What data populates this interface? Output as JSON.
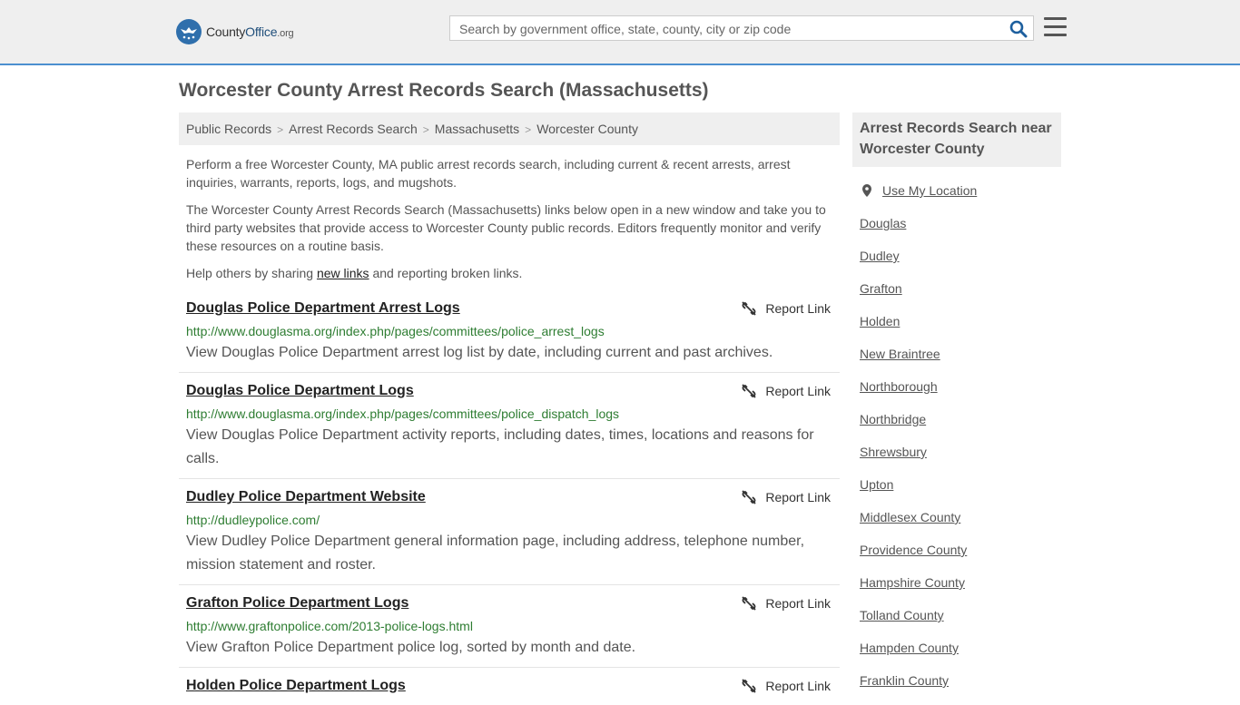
{
  "header": {
    "logo_text_county": "County",
    "logo_text_office": "Office",
    "logo_text_org": ".org",
    "search_placeholder": "Search by government office, state, county, city or zip code",
    "search_icon": "search-icon",
    "menu_icon": "hamburger-menu-icon"
  },
  "page": {
    "title": "Worcester County Arrest Records Search (Massachusetts)"
  },
  "breadcrumb": [
    "Public Records",
    "Arrest Records Search",
    "Massachusetts",
    "Worcester County"
  ],
  "intro": {
    "p1": "Perform a free Worcester County, MA public arrest records search, including current & recent arrests, arrest inquiries, warrants, reports, logs, and mugshots.",
    "p2": "The Worcester County Arrest Records Search (Massachusetts) links below open in a new window and take you to third party websites that provide access to Worcester County public records. Editors frequently monitor and verify these resources on a routine basis.",
    "p3_before": "Help others by sharing ",
    "p3_link": "new links",
    "p3_after": " and reporting broken links."
  },
  "report_label": "Report Link",
  "listings": [
    {
      "title": "Douglas Police Department Arrest Logs",
      "url": "http://www.douglasma.org/index.php/pages/committees/police_arrest_logs",
      "desc": "View Douglas Police Department arrest log list by date, including current and past archives."
    },
    {
      "title": "Douglas Police Department Logs",
      "url": "http://www.douglasma.org/index.php/pages/committees/police_dispatch_logs",
      "desc": "View Douglas Police Department activity reports, including dates, times, locations and reasons for calls."
    },
    {
      "title": "Dudley Police Department Website",
      "url": "http://dudleypolice.com/",
      "desc": "View Dudley Police Department general information page, including address, telephone number, mission statement and roster."
    },
    {
      "title": "Grafton Police Department Logs",
      "url": "http://www.graftonpolice.com/2013-police-logs.html",
      "desc": "View Grafton Police Department police log, sorted by month and date."
    },
    {
      "title": "Holden Police Department Logs",
      "url": "",
      "desc": ""
    }
  ],
  "sidebar": {
    "heading": "Arrest Records Search near Worcester County",
    "use_location": "Use My Location",
    "items": [
      "Douglas",
      "Dudley",
      "Grafton",
      "Holden",
      "New Braintree",
      "Northborough",
      "Northbridge",
      "Shrewsbury",
      "Upton",
      "Middlesex County",
      "Providence County",
      "Hampshire County",
      "Tolland County",
      "Hampden County",
      "Franklin County"
    ]
  }
}
